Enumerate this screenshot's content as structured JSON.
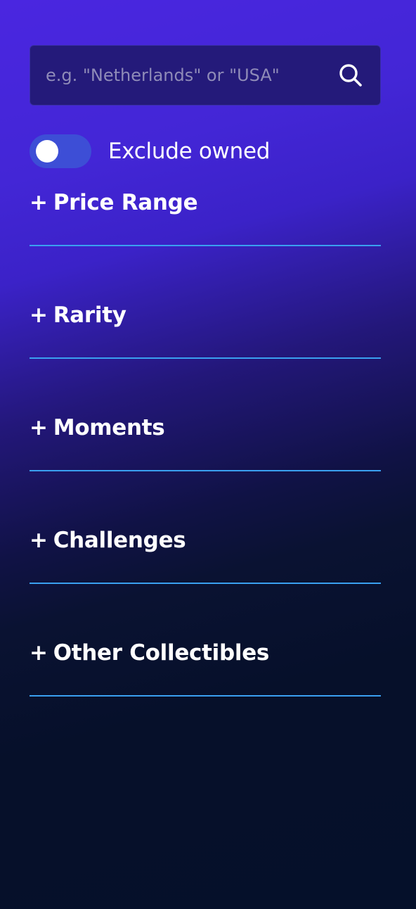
{
  "search": {
    "placeholder": "e.g. \"Netherlands\" or \"USA\"",
    "value": "",
    "icon": "search-icon"
  },
  "toggle": {
    "label": "Exclude owned",
    "checked": false,
    "track_color": "#3d4ed6"
  },
  "filters": [
    {
      "plus": "+",
      "label": "Price Range"
    },
    {
      "plus": "+",
      "label": "Rarity"
    },
    {
      "plus": "+",
      "label": "Moments"
    },
    {
      "plus": "+",
      "label": "Challenges"
    },
    {
      "plus": "+",
      "label": "Other Collectibles"
    }
  ],
  "colors": {
    "divider": "#3aa0f0",
    "search_bg": "#241a7a"
  }
}
